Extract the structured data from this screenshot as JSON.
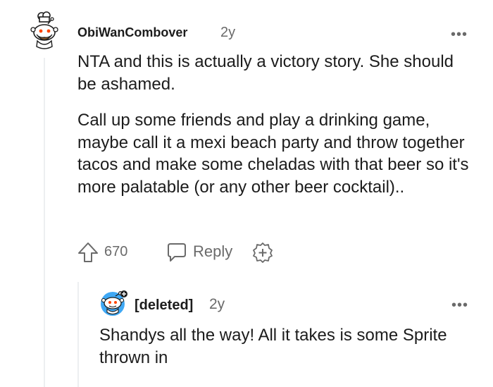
{
  "comment": {
    "username": "ObiWanCombover",
    "age": "2y",
    "more_label": "•••",
    "paragraphs": [
      "NTA and this is actually a victory story. She should be ashamed.",
      "Call up some friends and play a drinking game, maybe call it a mexi beach party and throw together tacos and make some cheladas with that beer so it's more palatable (or any other beer cocktail).."
    ],
    "votes": "670",
    "reply_label": "Reply",
    "icons": [
      "upvote-icon",
      "reply-icon",
      "award-icon",
      "more-options-icon"
    ]
  },
  "reply": {
    "username": "[deleted]",
    "age": "2y",
    "more_label": "•••",
    "text": "Shandys all the way! All it takes is some Sprite thrown in"
  },
  "colors": {
    "text": "#1c1c1c",
    "muted": "#6a6a6a",
    "thread_line": "#edeff1",
    "avatar_bg": "#3fa8f4",
    "snoo_orange": "#ff4500"
  }
}
